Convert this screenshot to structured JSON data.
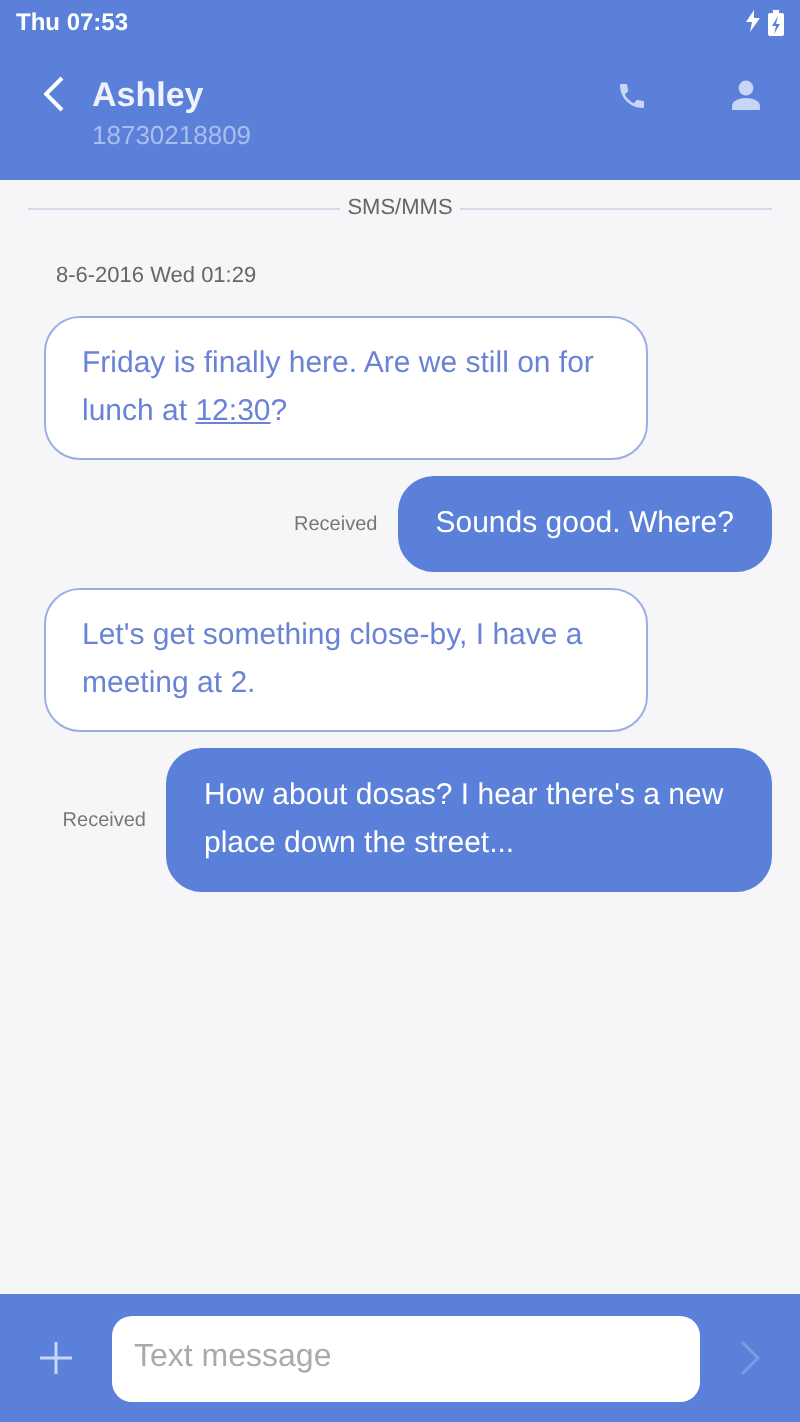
{
  "status_bar": {
    "time": "Thu 07:53"
  },
  "header": {
    "title": "Ashley",
    "subtitle": "18730218809"
  },
  "thread": {
    "channel": "SMS/MMS",
    "date": "8-6-2016 Wed 01:29",
    "messages": [
      {
        "kind": "incoming",
        "segments": [
          {
            "kind": "plain",
            "text": "Friday is finally here. Are we still on for lunch at "
          },
          {
            "kind": "link",
            "text": "12:30"
          },
          {
            "kind": "plain",
            "text": "?"
          }
        ]
      },
      {
        "kind": "outgoing",
        "status": "Received",
        "segments": [
          {
            "kind": "plain",
            "text": "Sounds good. Where?"
          }
        ]
      },
      {
        "kind": "incoming",
        "segments": [
          {
            "kind": "plain",
            "text": "Let's get something close-by, I have a meeting at 2."
          }
        ]
      },
      {
        "kind": "outgoing",
        "status": "Received",
        "segments": [
          {
            "kind": "plain",
            "text": "How about dosas? I hear there's a new place down the street..."
          }
        ]
      }
    ]
  },
  "composer": {
    "placeholder": "Text message"
  }
}
